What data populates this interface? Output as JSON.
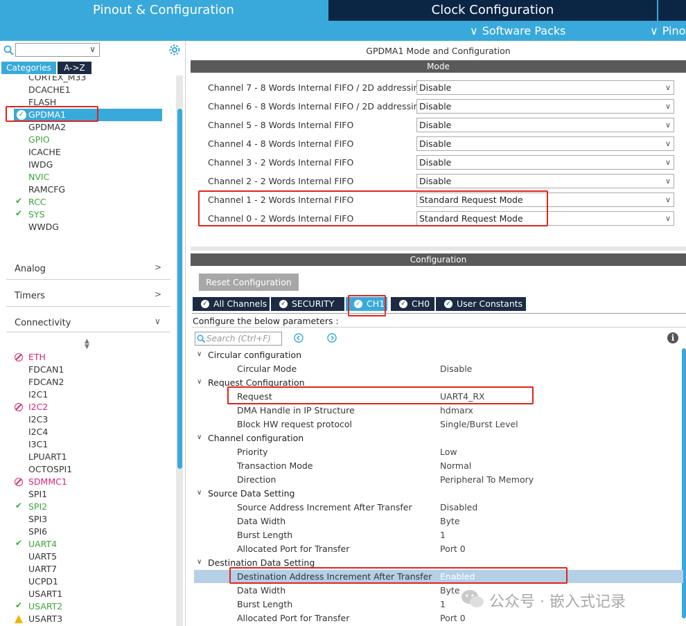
{
  "top_tabs": {
    "pinout": "Pinout & Configuration",
    "clock": "Clock Configuration",
    "software_packs": "Software Packs",
    "pinout_sub": "Pino"
  },
  "left": {
    "view_tabs": [
      "Categories",
      "A->Z"
    ],
    "list_items": [
      {
        "label": "CORTEX_M33",
        "status": "none"
      },
      {
        "label": "DCACHE1",
        "status": "none"
      },
      {
        "label": "FLASH",
        "status": "none"
      },
      {
        "label": "GPDMA1",
        "status": "ok-selected"
      },
      {
        "label": "GPDMA2",
        "status": "none"
      },
      {
        "label": "GPIO",
        "status": "green"
      },
      {
        "label": "ICACHE",
        "status": "none"
      },
      {
        "label": "IWDG",
        "status": "none"
      },
      {
        "label": "NVIC",
        "status": "green"
      },
      {
        "label": "RAMCFG",
        "status": "none"
      },
      {
        "label": "RCC",
        "status": "check"
      },
      {
        "label": "SYS",
        "status": "check"
      },
      {
        "label": "WWDG",
        "status": "none"
      }
    ],
    "categories": [
      "Analog",
      "Timers",
      "Connectivity"
    ],
    "connectivity_items": [
      {
        "label": "ETH",
        "status": "blocked"
      },
      {
        "label": "FDCAN1",
        "status": "none"
      },
      {
        "label": "FDCAN2",
        "status": "none"
      },
      {
        "label": "I2C1",
        "status": "none"
      },
      {
        "label": "I2C2",
        "status": "blocked"
      },
      {
        "label": "I2C3",
        "status": "none"
      },
      {
        "label": "I2C4",
        "status": "none"
      },
      {
        "label": "I3C1",
        "status": "none"
      },
      {
        "label": "LPUART1",
        "status": "none"
      },
      {
        "label": "OCTOSPI1",
        "status": "none"
      },
      {
        "label": "SDMMC1",
        "status": "blocked"
      },
      {
        "label": "SPI1",
        "status": "none"
      },
      {
        "label": "SPI2",
        "status": "check"
      },
      {
        "label": "SPI3",
        "status": "none"
      },
      {
        "label": "SPI6",
        "status": "none"
      },
      {
        "label": "UART4",
        "status": "check"
      },
      {
        "label": "UART5",
        "status": "none"
      },
      {
        "label": "UART7",
        "status": "none"
      },
      {
        "label": "UCPD1",
        "status": "none"
      },
      {
        "label": "USART1",
        "status": "none"
      },
      {
        "label": "USART2",
        "status": "check"
      },
      {
        "label": "USART3",
        "status": "warn"
      }
    ]
  },
  "right": {
    "title": "GPDMA1 Mode and Configuration",
    "mode_bar": "Mode",
    "mode_rows": [
      {
        "label": "Channel 7  - 8 Words Internal FIFO / 2D addressing",
        "value": "Disable"
      },
      {
        "label": "Channel 6  - 8 Words Internal FIFO / 2D addressing",
        "value": "Disable"
      },
      {
        "label": "Channel 5  - 8 Words Internal FIFO",
        "value": "Disable"
      },
      {
        "label": "Channel 4  - 8 Words Internal FIFO",
        "value": "Disable"
      },
      {
        "label": "Channel 3  - 2 Words Internal FIFO",
        "value": "Disable"
      },
      {
        "label": "Channel 2  - 2 Words Internal FIFO",
        "value": "Disable"
      },
      {
        "label": "Channel 1  - 2 Words Internal FIFO",
        "value": "Standard Request Mode"
      },
      {
        "label": "Channel 0  - 2 Words Internal FIFO",
        "value": "Standard Request Mode"
      }
    ],
    "config_bar": "Configuration",
    "reset_button": "Reset Configuration",
    "config_tabs": [
      "All Channels",
      "SECURITY",
      "CH1",
      "CH0",
      "User Constants"
    ],
    "configure_text": "Configure the below parameters :",
    "search_placeholder": "Search (Ctrl+F)",
    "groups": [
      {
        "title": "Circular configuration",
        "params": [
          {
            "name": "Circular Mode",
            "value": "Disable"
          }
        ]
      },
      {
        "title": "Request Configuration",
        "params": [
          {
            "name": "Request",
            "value": "UART4_RX"
          },
          {
            "name": "DMA Handle in IP Structure",
            "value": "hdmarx"
          },
          {
            "name": "Block HW request protocol",
            "value": "Single/Burst Level"
          }
        ]
      },
      {
        "title": "Channel configuration",
        "params": [
          {
            "name": "Priority",
            "value": "Low"
          },
          {
            "name": "Transaction Mode",
            "value": "Normal"
          },
          {
            "name": "Direction",
            "value": "Peripheral To Memory"
          }
        ]
      },
      {
        "title": "Source Data Setting",
        "params": [
          {
            "name": "Source Address Increment After Transfer",
            "value": "Disabled"
          },
          {
            "name": "Data Width",
            "value": "Byte"
          },
          {
            "name": "Burst Length",
            "value": "1"
          },
          {
            "name": "Allocated Port for Transfer",
            "value": "Port 0"
          }
        ]
      },
      {
        "title": "Destination Data Setting",
        "params": [
          {
            "name": "Destination Address Increment After Transfer",
            "value": "Enabled"
          },
          {
            "name": "Data Width",
            "value": "Byte"
          },
          {
            "name": "Burst Length",
            "value": "1"
          },
          {
            "name": "Allocated Port for Transfer",
            "value": "Port 0"
          }
        ]
      }
    ]
  },
  "watermark": "公众号 · 嵌入式记录",
  "colors": {
    "accent": "#39a9db",
    "dark_tab": "#1c2a43",
    "highlight": "#e2231a",
    "selected_row": "#b5cfe6"
  }
}
